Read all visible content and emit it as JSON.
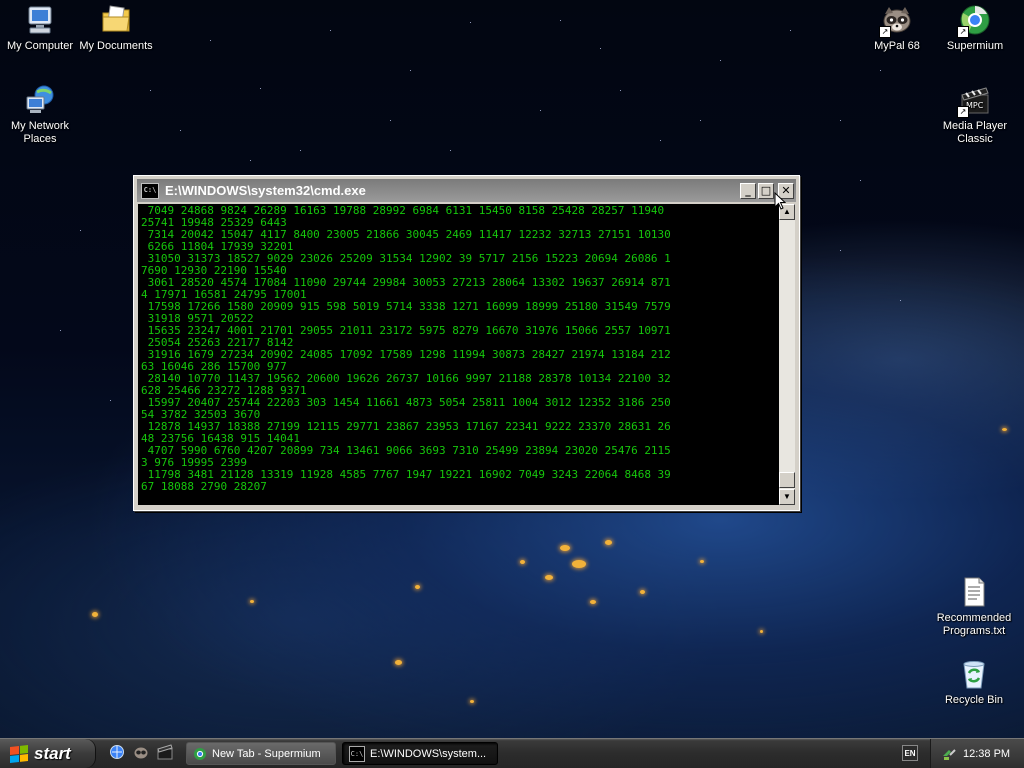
{
  "desktop": {
    "icons": [
      {
        "label": "My Computer",
        "glyph": "computer-icon"
      },
      {
        "label": "My Documents",
        "glyph": "documents-folder-icon"
      },
      {
        "label": "My Network Places",
        "glyph": "network-places-icon"
      },
      {
        "label": "MyPal 68",
        "glyph": "mypal-raccoon-icon"
      },
      {
        "label": "Supermium",
        "glyph": "supermium-browser-icon"
      },
      {
        "label": "Media Player Classic",
        "glyph": "media-player-classic-icon"
      },
      {
        "label": "Recommended Programs.txt",
        "glyph": "text-file-icon"
      },
      {
        "label": "Recycle Bin",
        "glyph": "recycle-bin-icon"
      }
    ]
  },
  "cmd_window": {
    "title": "E:\\WINDOWS\\system32\\cmd.exe",
    "app_icon_text": "C:\\",
    "minimize_glyph": "_",
    "maximize_glyph": "□",
    "close_glyph": "✕",
    "console_lines": [
      " 7049 24868 9824 26289 16163 19788 28992 6984 6131 15450 8158 25428 28257 11940",
      "25741 19948 25329 6443",
      " 7314 20042 15047 4117 8400 23005 21866 30045 2469 11417 12232 32713 27151 10130",
      " 6266 11804 17939 32201",
      " 31050 31373 18527 9029 23026 25209 31534 12902 39 5717 2156 15223 20694 26086 1",
      "7690 12930 22190 15540",
      " 3061 28520 4574 17084 11090 29744 29984 30053 27213 28064 13302 19637 26914 871",
      "4 17971 16581 24795 17001",
      " 17598 17266 1580 20909 915 598 5019 5714 3338 1271 16099 18999 25180 31549 7579",
      " 31918 9571 20522",
      " 15635 23247 4001 21701 29055 21011 23172 5975 8279 16670 31976 15066 2557 10971",
      " 25054 25263 22177 8142",
      " 31916 1679 27234 20902 24085 17092 17589 1298 11994 30873 28427 21974 13184 212",
      "63 16046 286 15700 977",
      " 28140 10770 11437 19562 20600 19626 26737 10166 9997 21188 28378 10134 22100 32",
      "628 25466 23272 1288 9371",
      " 15997 20407 25744 22203 303 1454 11661 4873 5054 25811 1004 3012 12352 3186 250",
      "54 3782 32503 3670",
      " 12878 14937 18388 27199 12115 29771 23867 23953 17167 22341 9222 23370 28631 26",
      "48 23756 16438 915 14041",
      " 4707 5990 6760 4207 20899 734 13461 9066 3693 7310 25499 23894 23020 25476 2115",
      "3 976 19995 2399",
      " 11798 3481 21128 13319 11928 4585 7767 1947 19221 16902 7049 3243 22064 8468 39",
      "67 18088 2790 28207"
    ]
  },
  "taskbar": {
    "start_label": "start",
    "quick_launch": [
      "browser-quicklaunch-icon",
      "mypal-quicklaunch-icon",
      "media-player-quicklaunch-icon"
    ],
    "tasks": [
      {
        "label": "New Tab - Supermium",
        "icon": "supermium-task-icon",
        "active": false
      },
      {
        "label": "E:\\WINDOWS\\system...",
        "icon": "cmd-task-icon",
        "active": true
      }
    ],
    "language": "EN",
    "clock": "12:38 PM"
  },
  "colors": {
    "console_text": "#16c60c",
    "console_bg": "#000000",
    "title_inactive": "#8a8a8a"
  }
}
